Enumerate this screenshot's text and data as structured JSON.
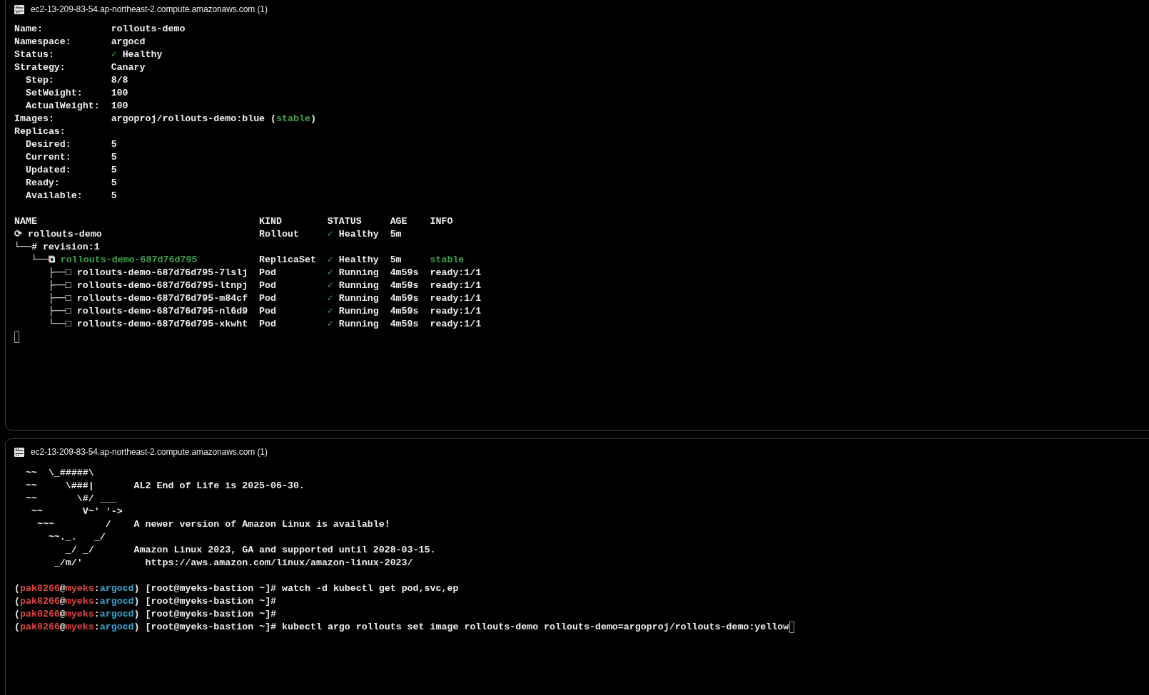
{
  "panels": [
    {
      "kind": "rollout-status",
      "title": "ec2-13-209-83-54.ap-northeast-2.compute.amazonaws.com (1)",
      "fields": [
        {
          "label": "Name:",
          "value": [
            {
              "text": "rollouts-demo",
              "kind": "plain"
            }
          ]
        },
        {
          "label": "Namespace:",
          "value": [
            {
              "text": "argocd",
              "kind": "plain"
            }
          ]
        },
        {
          "label": "Status:",
          "value": [
            {
              "text": "✓",
              "kind": "ok"
            },
            {
              "text": " Healthy",
              "kind": "plain"
            }
          ]
        },
        {
          "label": "Strategy:",
          "value": [
            {
              "text": "Canary",
              "kind": "plain"
            }
          ],
          "children": [
            {
              "label": "Step:",
              "value": [
                {
                  "text": "8/8",
                  "kind": "plain"
                }
              ]
            },
            {
              "label": "SetWeight:",
              "value": [
                {
                  "text": "100",
                  "kind": "plain"
                }
              ]
            },
            {
              "label": "ActualWeight:",
              "value": [
                {
                  "text": "100",
                  "kind": "plain"
                }
              ]
            }
          ]
        },
        {
          "label": "Images:",
          "value": [
            {
              "text": "argoproj/rollouts-demo:blue (",
              "kind": "plain"
            },
            {
              "text": "stable",
              "kind": "ok"
            },
            {
              "text": ")",
              "kind": "plain"
            }
          ]
        },
        {
          "label": "Replicas:",
          "children": [
            {
              "label": "Desired:",
              "value": [
                {
                  "text": "5",
                  "kind": "plain"
                }
              ]
            },
            {
              "label": "Current:",
              "value": [
                {
                  "text": "5",
                  "kind": "plain"
                }
              ]
            },
            {
              "label": "Updated:",
              "value": [
                {
                  "text": "5",
                  "kind": "plain"
                }
              ]
            },
            {
              "label": "Ready:",
              "value": [
                {
                  "text": "5",
                  "kind": "plain"
                }
              ]
            },
            {
              "label": "Available:",
              "value": [
                {
                  "text": "5",
                  "kind": "plain"
                }
              ]
            }
          ]
        }
      ],
      "table": {
        "columns": [
          "NAME",
          "KIND",
          "STATUS",
          "AGE",
          "INFO"
        ],
        "rows": [
          {
            "kind": "rollout",
            "prefix": "⟳",
            "name": "rollouts-demo",
            "type": "Rollout",
            "check": "✓",
            "status": "Healthy",
            "age": "5m",
            "children": [
              {
                "kind": "revision",
                "prefix": "└──#",
                "name": "revision:1",
                "children": [
                  {
                    "kind": "replicaset",
                    "prefix": "└──⧉",
                    "name": "rollouts-demo-687d76d795",
                    "type": "ReplicaSet",
                    "check": "✓",
                    "status": "Healthy",
                    "age": "5m",
                    "info": "stable",
                    "children": [
                      {
                        "kind": "pod",
                        "prefix": "├──□",
                        "name": "rollouts-demo-687d76d795-7lslj",
                        "type": "Pod",
                        "check": "✓",
                        "status": "Running",
                        "age": "4m59s",
                        "info": "ready:1/1"
                      },
                      {
                        "kind": "pod",
                        "prefix": "├──□",
                        "name": "rollouts-demo-687d76d795-ltnpj",
                        "type": "Pod",
                        "check": "✓",
                        "status": "Running",
                        "age": "4m59s",
                        "info": "ready:1/1"
                      },
                      {
                        "kind": "pod",
                        "prefix": "├──□",
                        "name": "rollouts-demo-687d76d795-m84cf",
                        "type": "Pod",
                        "check": "✓",
                        "status": "Running",
                        "age": "4m59s",
                        "info": "ready:1/1"
                      },
                      {
                        "kind": "pod",
                        "prefix": "├──□",
                        "name": "rollouts-demo-687d76d795-nl6d9",
                        "type": "Pod",
                        "check": "✓",
                        "status": "Running",
                        "age": "4m59s",
                        "info": "ready:1/1"
                      },
                      {
                        "kind": "pod",
                        "prefix": "└──□",
                        "name": "rollouts-demo-687d76d795-xkwht",
                        "type": "Pod",
                        "check": "✓",
                        "status": "Running",
                        "age": "4m59s",
                        "info": "ready:1/1"
                      }
                    ]
                  }
                ]
              }
            ]
          }
        ]
      },
      "cursor": true
    },
    {
      "kind": "shell",
      "title": "ec2-13-209-83-54.ap-northeast-2.compute.amazonaws.com (1)",
      "motd": [
        {
          "art": "  ~~  \\_#####\\"
        },
        {
          "art": "  ~~     \\###|",
          "message": "AL2 End of Life is 2025-06-30."
        },
        {
          "art": "  ~~       \\#/ ___"
        },
        {
          "art": "   ~~       V~' '->"
        },
        {
          "art": "    ~~~         /",
          "message": "A newer version of Amazon Linux is available!"
        },
        {
          "art": "      ~~._.   _/"
        },
        {
          "art": "         _/ _/",
          "message": "Amazon Linux 2023, GA and supported until 2028-03-15."
        },
        {
          "art": "       _/m/'",
          "message": "https://aws.amazon.com/linux/amazon-linux-2023/",
          "indented": true
        }
      ],
      "prompts": [
        {
          "segments": [
            {
              "text": "(",
              "kind": "plain"
            },
            {
              "text": "pak8266",
              "kind": "user"
            },
            {
              "text": "@",
              "kind": "plain"
            },
            {
              "text": "myeks",
              "kind": "user"
            },
            {
              "text": ":",
              "kind": "plain"
            },
            {
              "text": "argocd",
              "kind": "namespace"
            },
            {
              "text": ")",
              "kind": "plain"
            }
          ],
          "shell": "[root@myeks-bastion ~]#",
          "command": "watch -d kubectl get pod,svc,ep",
          "cursor": false
        },
        {
          "segments": [
            {
              "text": "(",
              "kind": "plain"
            },
            {
              "text": "pak8266",
              "kind": "user"
            },
            {
              "text": "@",
              "kind": "plain"
            },
            {
              "text": "myeks",
              "kind": "user"
            },
            {
              "text": ":",
              "kind": "plain"
            },
            {
              "text": "argocd",
              "kind": "namespace"
            },
            {
              "text": ")",
              "kind": "plain"
            }
          ],
          "shell": "[root@myeks-bastion ~]#",
          "cursor": false
        },
        {
          "segments": [
            {
              "text": "(",
              "kind": "plain"
            },
            {
              "text": "pak8266",
              "kind": "user"
            },
            {
              "text": "@",
              "kind": "plain"
            },
            {
              "text": "myeks",
              "kind": "user"
            },
            {
              "text": ":",
              "kind": "plain"
            },
            {
              "text": "argocd",
              "kind": "namespace"
            },
            {
              "text": ")",
              "kind": "plain"
            }
          ],
          "shell": "[root@myeks-bastion ~]#",
          "cursor": false
        },
        {
          "segments": [
            {
              "text": "(",
              "kind": "plain"
            },
            {
              "text": "pak8266",
              "kind": "user"
            },
            {
              "text": "@",
              "kind": "plain"
            },
            {
              "text": "myeks",
              "kind": "user"
            },
            {
              "text": ":",
              "kind": "plain"
            },
            {
              "text": "argocd",
              "kind": "namespace"
            },
            {
              "text": ")",
              "kind": "plain"
            }
          ],
          "shell": "[root@myeks-bastion ~]#",
          "command": "kubectl argo rollouts set image rollouts-demo rollouts-demo=argoproj/rollouts-demo:yellow",
          "cursor": true
        }
      ]
    }
  ]
}
